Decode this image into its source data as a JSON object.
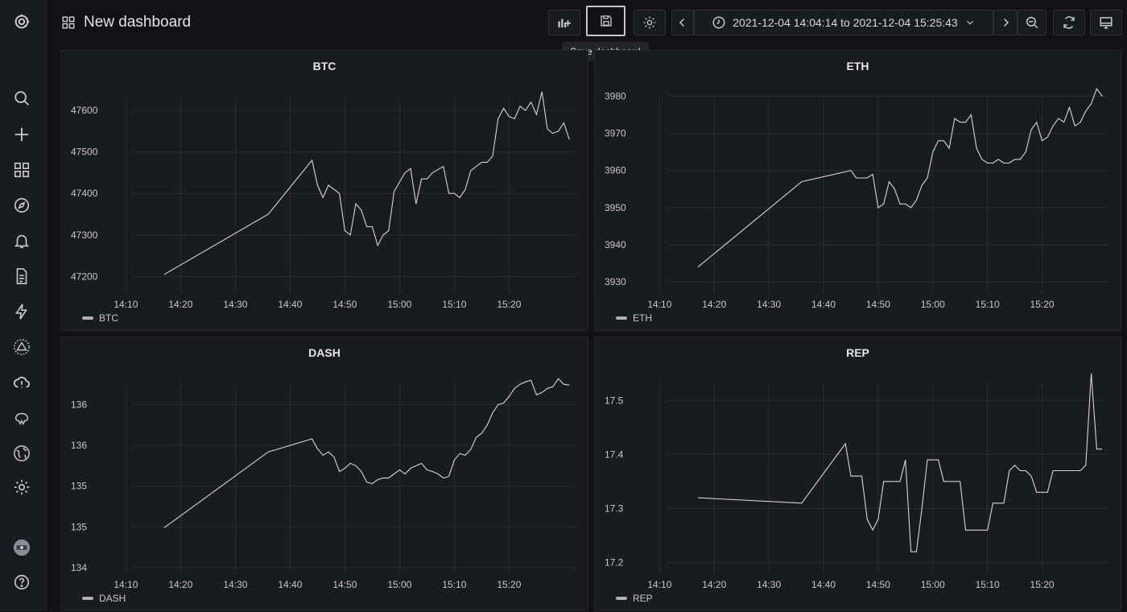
{
  "header": {
    "title": "New dashboard",
    "time_range": "2021-12-04 14:04:14 to 2021-12-04 15:25:43",
    "tooltip": "Save dashboard"
  },
  "colors": {
    "line": "#d6d6d6",
    "grid": "#2a2c31",
    "legend_swatch": "#b0b0b0"
  },
  "sidebar": {
    "icons": [
      "grafana-logo-icon",
      "search-icon",
      "plus-icon",
      "dashboards-icon",
      "explore-icon",
      "alerting-icon",
      "reports-icon",
      "lightning-icon",
      "triangle-icon",
      "cloud-alert-icon",
      "brain-icon",
      "globe-icon",
      "gear-icon",
      "avatar",
      "help-icon"
    ]
  },
  "chart_data": [
    {
      "type": "line",
      "title": "BTC",
      "legend": "BTC",
      "x_ticks": [
        "14:10",
        "14:20",
        "14:30",
        "14:40",
        "14:50",
        "15:00",
        "15:10",
        "15:20"
      ],
      "y_ticks": [
        "47200",
        "47300",
        "47400",
        "47500",
        "47600"
      ],
      "ylim": [
        47160,
        47670
      ],
      "xlim_min": [
        7,
        92
      ],
      "x_min": [
        17,
        36,
        44,
        45,
        46,
        47,
        49,
        50,
        51,
        52,
        53,
        54,
        55,
        56,
        57,
        58,
        59,
        61,
        62,
        63,
        64,
        65,
        66,
        68,
        69,
        70,
        71,
        72,
        73,
        74,
        75,
        76,
        77,
        78,
        79,
        80,
        81,
        82,
        83,
        84,
        85,
        86,
        87,
        88,
        89,
        90,
        91
      ],
      "y": [
        47205,
        47350,
        47480,
        47420,
        47390,
        47420,
        47400,
        47310,
        47300,
        47375,
        47360,
        47320,
        47320,
        47275,
        47300,
        47310,
        47405,
        47450,
        47460,
        47375,
        47435,
        47435,
        47450,
        47465,
        47400,
        47400,
        47390,
        47410,
        47455,
        47465,
        47475,
        47475,
        47490,
        47580,
        47605,
        47585,
        47580,
        47610,
        47600,
        47620,
        47590,
        47645,
        47555,
        47545,
        47550,
        47570,
        47530
      ]
    },
    {
      "type": "line",
      "title": "ETH",
      "legend": "ETH",
      "x_ticks": [
        "14:10",
        "14:20",
        "14:30",
        "14:40",
        "14:50",
        "15:00",
        "15:10",
        "15:20"
      ],
      "y_ticks": [
        "3930",
        "3940",
        "3950",
        "3960",
        "3970",
        "3980"
      ],
      "ylim": [
        3927,
        3984
      ],
      "xlim_min": [
        7,
        92
      ],
      "x_min": [
        17,
        36,
        45,
        46,
        47,
        48,
        49,
        50,
        51,
        52,
        53,
        54,
        55,
        56,
        57,
        58,
        59,
        60,
        61,
        62,
        63,
        64,
        65,
        66,
        67,
        68,
        69,
        70,
        71,
        72,
        73,
        74,
        75,
        76,
        77,
        78,
        79,
        80,
        81,
        82,
        83,
        84,
        85,
        86,
        87,
        88,
        89,
        90,
        91
      ],
      "y": [
        3934,
        3957,
        3960,
        3958,
        3958,
        3958,
        3959,
        3950,
        3951,
        3957,
        3955,
        3951,
        3951,
        3950,
        3952,
        3956,
        3958,
        3965,
        3968,
        3968,
        3966,
        3974,
        3973,
        3973,
        3975,
        3966,
        3963,
        3962,
        3962,
        3963,
        3962,
        3962,
        3963,
        3963,
        3965,
        3971,
        3973,
        3968,
        3969,
        3972,
        3974,
        3973,
        3977,
        3972,
        3973,
        3976,
        3978,
        3982,
        3980
      ]
    },
    {
      "type": "line",
      "title": "DASH",
      "legend": "DASH",
      "x_ticks": [
        "14:10",
        "14:20",
        "14:30",
        "14:40",
        "14:50",
        "15:00",
        "15:10",
        "15:20"
      ],
      "y_ticks": [
        "134",
        "135",
        "135",
        "136",
        "136"
      ],
      "ylim": [
        133.93,
        136.45
      ],
      "xlim_min": [
        7,
        92
      ],
      "x_min": [
        17,
        36,
        44,
        45,
        46,
        47,
        48,
        49,
        50,
        51,
        52,
        53,
        54,
        55,
        56,
        57,
        58,
        59,
        60,
        61,
        62,
        63,
        64,
        65,
        66,
        67,
        68,
        69,
        70,
        71,
        72,
        73,
        74,
        75,
        76,
        77,
        78,
        79,
        80,
        81,
        82,
        83,
        84,
        85,
        86,
        87,
        88,
        89,
        90,
        91
      ],
      "y": [
        134.49,
        135.42,
        135.58,
        135.46,
        135.38,
        135.42,
        135.36,
        135.18,
        135.22,
        135.28,
        135.25,
        135.18,
        135.05,
        135.03,
        135.08,
        135.1,
        135.1,
        135.15,
        135.2,
        135.15,
        135.22,
        135.25,
        135.28,
        135.2,
        135.18,
        135.15,
        135.1,
        135.12,
        135.32,
        135.4,
        135.38,
        135.45,
        135.6,
        135.65,
        135.75,
        135.9,
        136.0,
        136.02,
        136.1,
        136.2,
        136.25,
        136.28,
        136.3,
        136.12,
        136.15,
        136.2,
        136.22,
        136.32,
        136.25,
        136.24
      ]
    },
    {
      "type": "line",
      "title": "REP",
      "legend": "REP",
      "x_ticks": [
        "14:10",
        "14:20",
        "14:30",
        "14:40",
        "14:50",
        "15:00",
        "15:10",
        "15:20"
      ],
      "y_ticks": [
        "17.2",
        "17.3",
        "17.4",
        "17.5"
      ],
      "ylim": [
        17.18,
        17.56
      ],
      "xlim_min": [
        7,
        92
      ],
      "x_min": [
        17,
        36,
        44,
        45,
        46,
        47,
        48,
        49,
        50,
        51,
        52,
        53,
        54,
        55,
        56,
        57,
        58,
        59,
        60,
        61,
        62,
        63,
        64,
        65,
        66,
        67,
        68,
        69,
        70,
        71,
        72,
        73,
        74,
        75,
        76,
        77,
        78,
        79,
        80,
        81,
        82,
        83,
        84,
        85,
        86,
        87,
        88,
        89,
        90,
        91
      ],
      "y": [
        17.32,
        17.31,
        17.42,
        17.36,
        17.36,
        17.36,
        17.28,
        17.26,
        17.28,
        17.35,
        17.35,
        17.35,
        17.35,
        17.39,
        17.22,
        17.22,
        17.3,
        17.39,
        17.39,
        17.39,
        17.35,
        17.35,
        17.35,
        17.35,
        17.26,
        17.26,
        17.26,
        17.26,
        17.26,
        17.31,
        17.31,
        17.31,
        17.37,
        17.38,
        17.37,
        17.37,
        17.36,
        17.33,
        17.33,
        17.33,
        17.37,
        17.37,
        17.37,
        17.37,
        17.37,
        17.37,
        17.38,
        17.55,
        17.41,
        17.41
      ]
    }
  ]
}
